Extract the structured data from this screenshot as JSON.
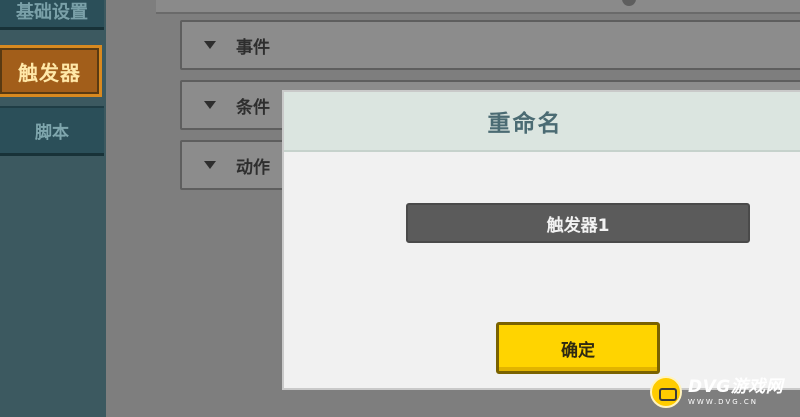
{
  "sidebar": {
    "tabs": [
      {
        "label": "基础设置"
      },
      {
        "label": "触发器"
      },
      {
        "label": "脚本"
      }
    ]
  },
  "sections": [
    {
      "label": "事件"
    },
    {
      "label": "条件"
    },
    {
      "label": "动作"
    }
  ],
  "dialog": {
    "title": "重命名",
    "name_value": "触发器1",
    "confirm_label": "确定"
  },
  "watermark": {
    "main": "DVG游戏网",
    "sub": "WWW.DVG.CN"
  }
}
